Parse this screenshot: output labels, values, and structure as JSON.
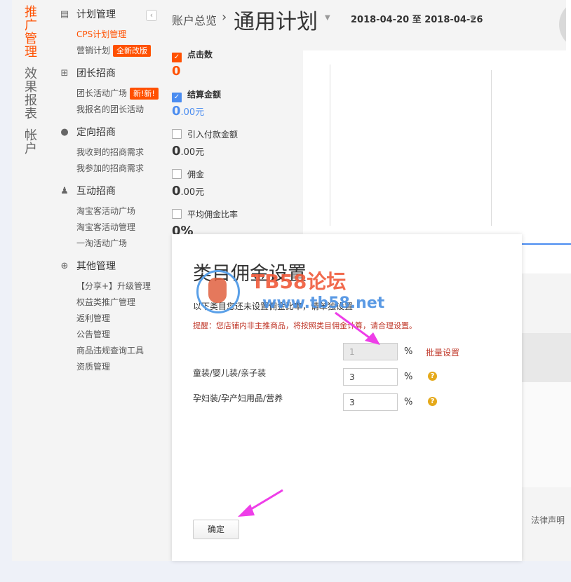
{
  "nav_groups": [
    {
      "label": "推广管理",
      "active": true
    },
    {
      "label": "效果报表",
      "active": false
    },
    {
      "label": "帐户",
      "active": false
    }
  ],
  "sidebar": {
    "sections": [
      {
        "title": "计划管理",
        "icon": "clipboard-icon",
        "items": [
          {
            "label": "CPS计划管理",
            "active": true,
            "badge": ""
          },
          {
            "label": "营销计划",
            "active": false,
            "badge": "全新改版"
          }
        ]
      },
      {
        "title": "团长招商",
        "icon": "grid-icon",
        "items": [
          {
            "label": "团长活动广场",
            "active": false,
            "badge": "新!新!"
          },
          {
            "label": "我报名的团长活动",
            "active": false,
            "badge": ""
          }
        ]
      },
      {
        "title": "定向招商",
        "icon": "location-pin-icon",
        "items": [
          {
            "label": "我收到的招商需求",
            "active": false,
            "badge": ""
          },
          {
            "label": "我参加的招商需求",
            "active": false,
            "badge": ""
          }
        ]
      },
      {
        "title": "互动招商",
        "icon": "people-icon",
        "items": [
          {
            "label": "淘宝客活动广场",
            "active": false,
            "badge": ""
          },
          {
            "label": "淘宝客活动管理",
            "active": false,
            "badge": ""
          },
          {
            "label": "一淘活动广场",
            "active": false,
            "badge": ""
          }
        ]
      },
      {
        "title": "其他管理",
        "icon": "plus-circle-icon",
        "items": [
          {
            "label": "【分享+】升级管理",
            "active": false,
            "badge": ""
          },
          {
            "label": "权益类推广管理",
            "active": false,
            "badge": ""
          },
          {
            "label": "返利管理",
            "active": false,
            "badge": ""
          },
          {
            "label": "公告管理",
            "active": false,
            "badge": ""
          },
          {
            "label": "商品违规查询工具",
            "active": false,
            "badge": ""
          },
          {
            "label": "资质管理",
            "active": false,
            "badge": ""
          }
        ]
      }
    ],
    "collapse_glyph": "‹"
  },
  "header": {
    "breadcrumb_root": "账户总览",
    "breadcrumb_sep": "›",
    "plan_name": "通用计划",
    "date_range": "2018-04-20 至 2018-04-26"
  },
  "metrics": [
    {
      "label": "点击数",
      "value": "0",
      "unit": "",
      "checked": true,
      "color": "orange",
      "bold": true
    },
    {
      "label": "结算金额",
      "value": "0",
      "decimal": ".00",
      "unit": "元",
      "checked": true,
      "color": "blue",
      "bold": true
    },
    {
      "label": "引入付款金额",
      "value": "0",
      "decimal": ".00",
      "unit": "元",
      "checked": false,
      "color": "",
      "bold": false
    },
    {
      "label": "佣金",
      "value": "0",
      "decimal": ".00",
      "unit": "元",
      "checked": false,
      "color": "",
      "bold": false
    },
    {
      "label": "平均佣金比率",
      "value": "0%",
      "unit": "",
      "checked": false,
      "color": "",
      "bold": false
    }
  ],
  "modal": {
    "title": "类目佣金设置",
    "description": "以下类目您还未设置佣金比率，请单独设置",
    "warning": "提醒：您店铺内非主推商品，将按照类目佣金计算，请合理设置。",
    "batch": {
      "value": "1",
      "pct": "%",
      "link": "批量设置"
    },
    "rows": [
      {
        "label": "童装/婴儿装/亲子装",
        "value": "3",
        "pct": "%",
        "help": "?"
      },
      {
        "label": "孕妇装/孕产妇用品/营养",
        "value": "3",
        "pct": "%",
        "help": "?"
      }
    ],
    "confirm_label": "确定"
  },
  "watermark": {
    "line1": "TB58论坛",
    "line2": "www.tb58.net"
  },
  "footer": {
    "legal_link": "法律声明"
  }
}
